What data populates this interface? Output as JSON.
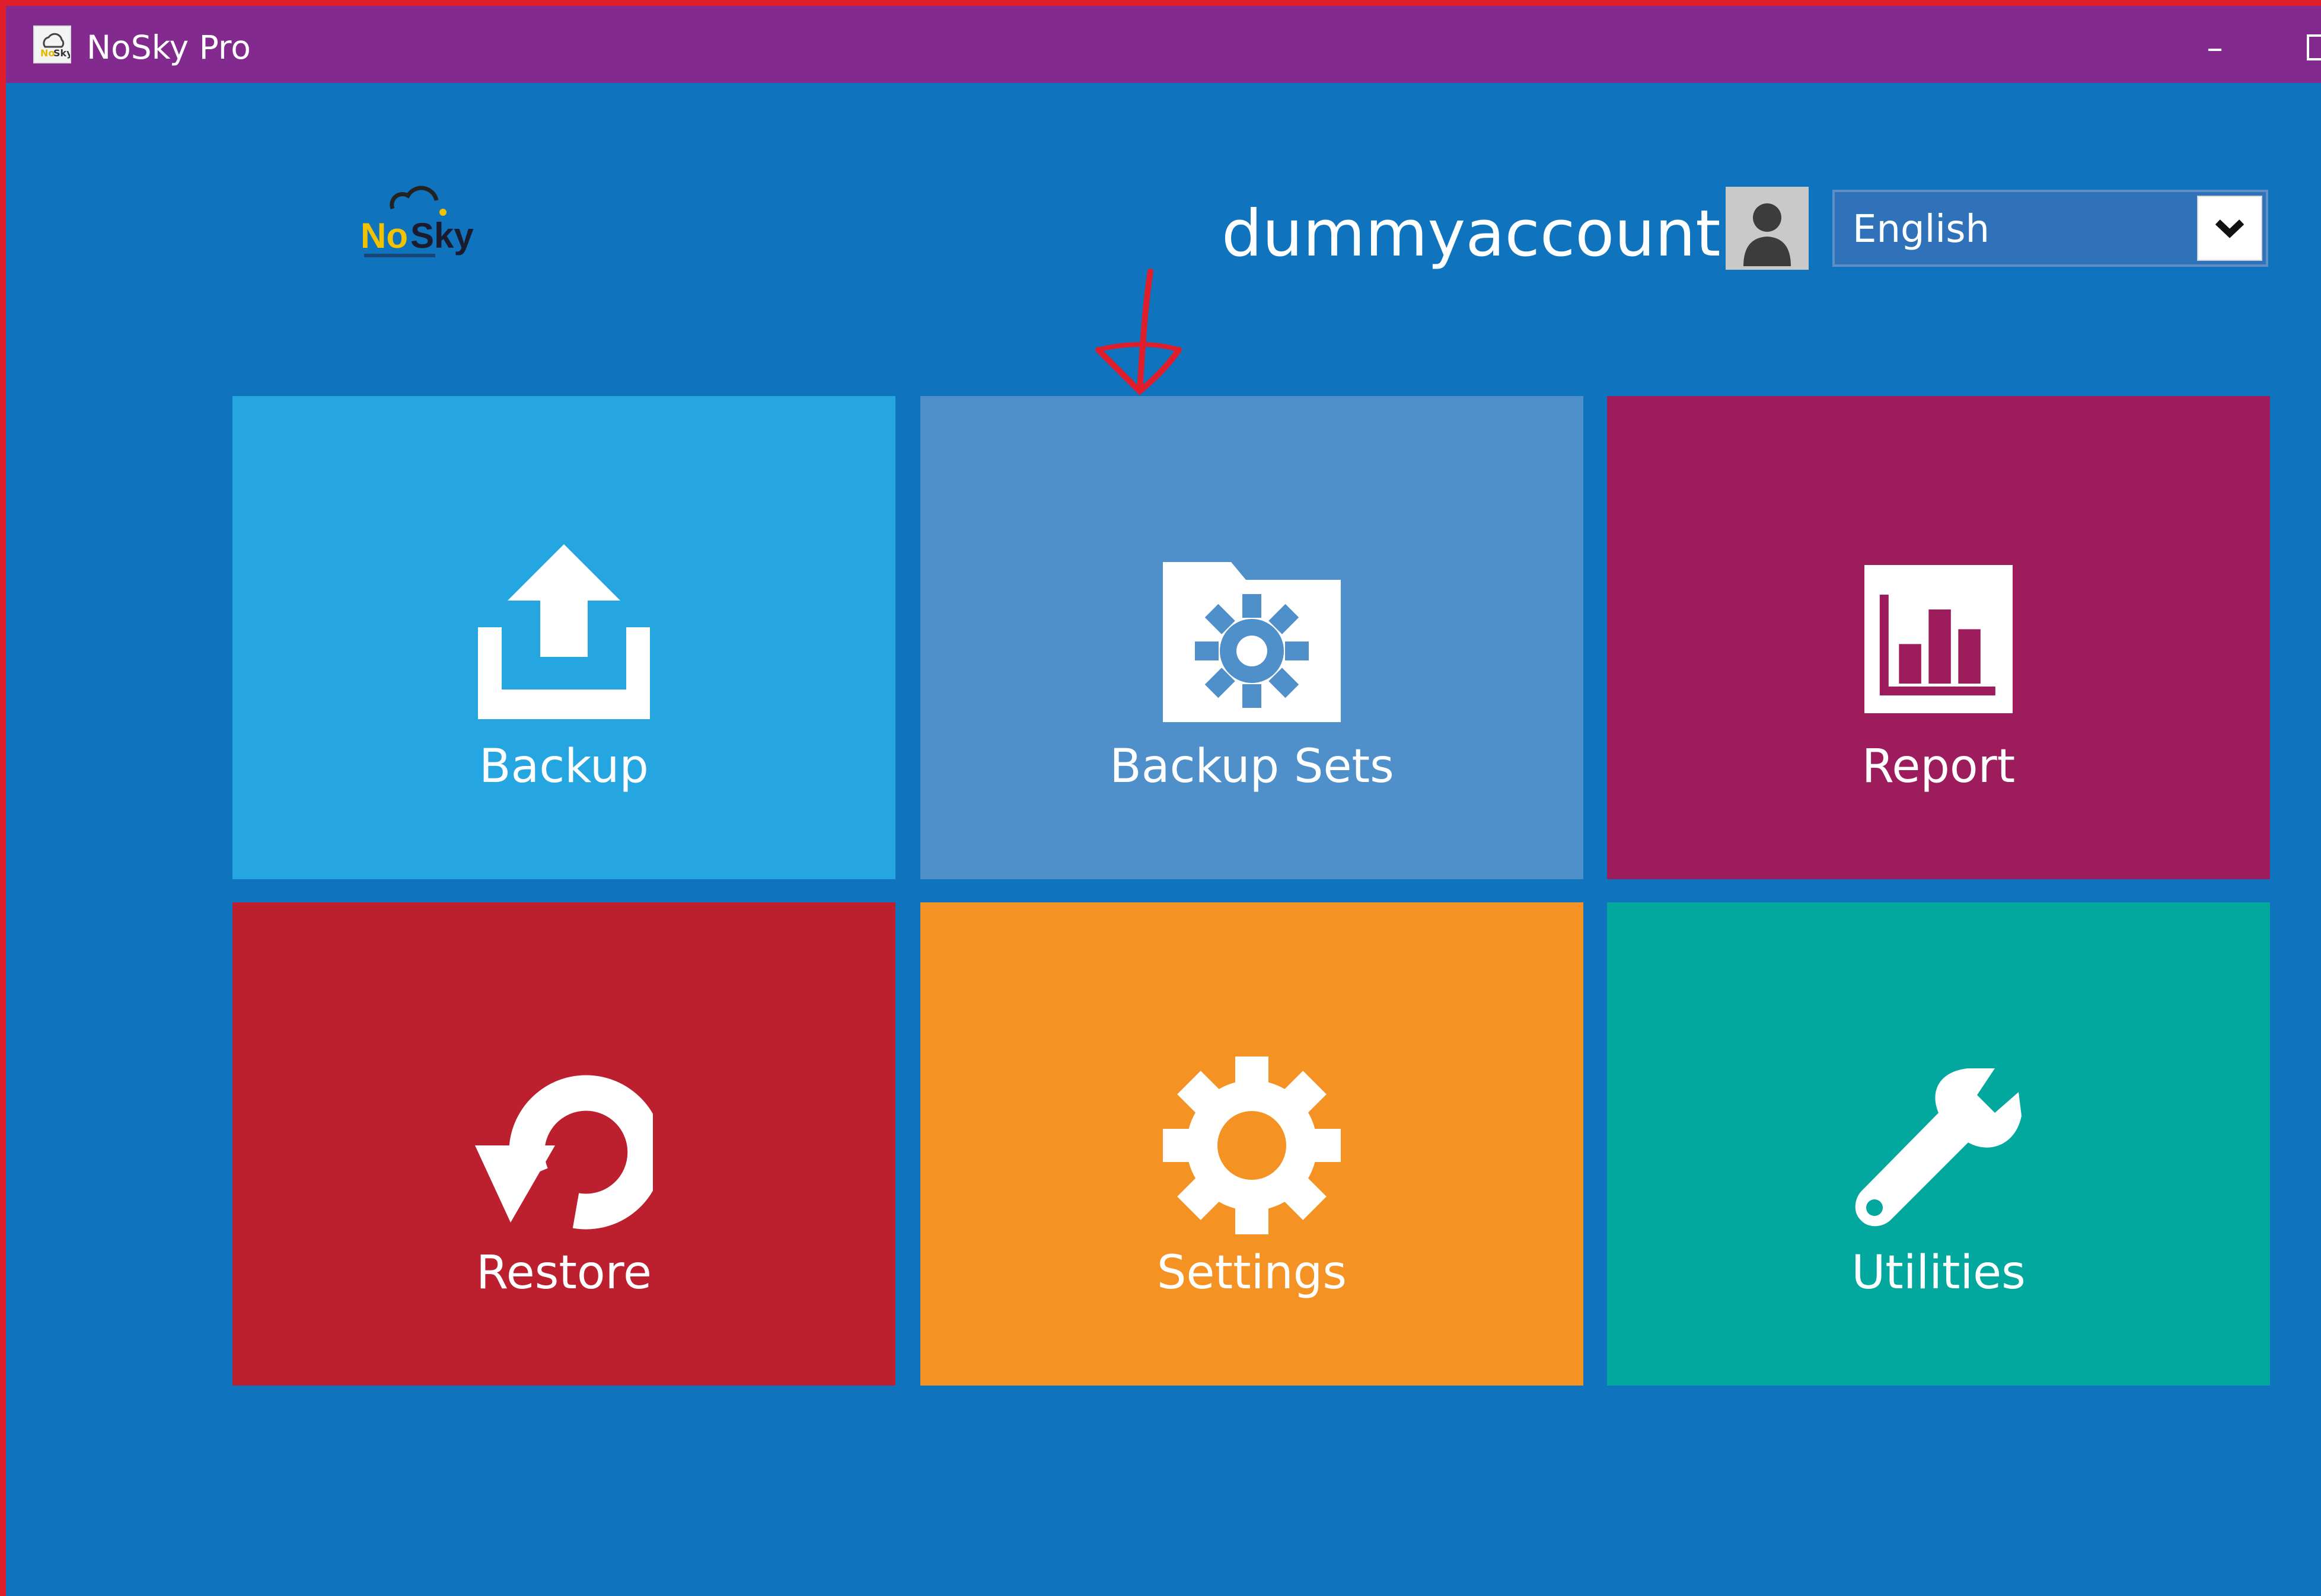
{
  "window": {
    "title": "NoSky Pro",
    "minimize_glyph": "–"
  },
  "header": {
    "logo_text": "NoSky",
    "username": "dummyaccount",
    "language": {
      "selected": "English"
    }
  },
  "tiles": [
    {
      "label": "Backup",
      "color": "#26a6e0",
      "icon": "upload-icon"
    },
    {
      "label": "Backup Sets",
      "color": "#4f8fca",
      "icon": "folder-gear-icon"
    },
    {
      "label": "Report",
      "color": "#9d1d5c",
      "icon": "bar-chart-icon"
    },
    {
      "label": "Restore",
      "color": "#bc1f2d",
      "icon": "restore-icon"
    },
    {
      "label": "Settings",
      "color": "#f59224",
      "icon": "gear-icon"
    },
    {
      "label": "Utilities",
      "color": "#02a89d",
      "icon": "wrench-icon"
    }
  ],
  "colors": {
    "background": "#0f74bd",
    "titlebar": "#822a8e",
    "annotation": "#e01d2b"
  }
}
